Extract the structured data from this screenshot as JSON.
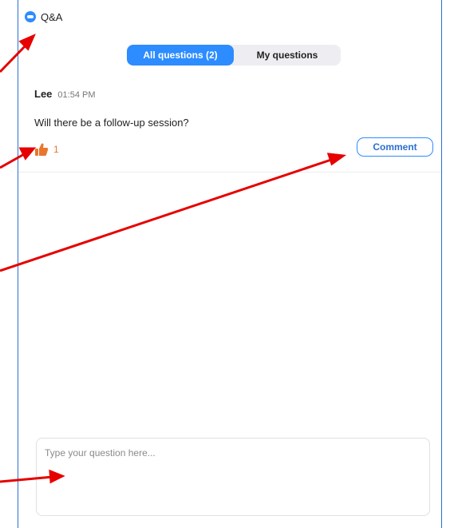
{
  "window": {
    "title": "Q&A"
  },
  "tabs": [
    {
      "label": "All questions (2)",
      "active": true
    },
    {
      "label": "My questions",
      "active": false
    }
  ],
  "question": {
    "author": "Lee",
    "time": "01:54 PM",
    "text": "Will there be a follow-up session?",
    "likes": "1",
    "comment_label": "Comment"
  },
  "input": {
    "placeholder": "Type your question here..."
  },
  "colors": {
    "accent": "#2d8cff",
    "like": "#e8762d",
    "annotation_arrow": "#e60000"
  },
  "icons": {
    "app": "zoom-app-icon",
    "like": "thumbs-up-icon"
  }
}
